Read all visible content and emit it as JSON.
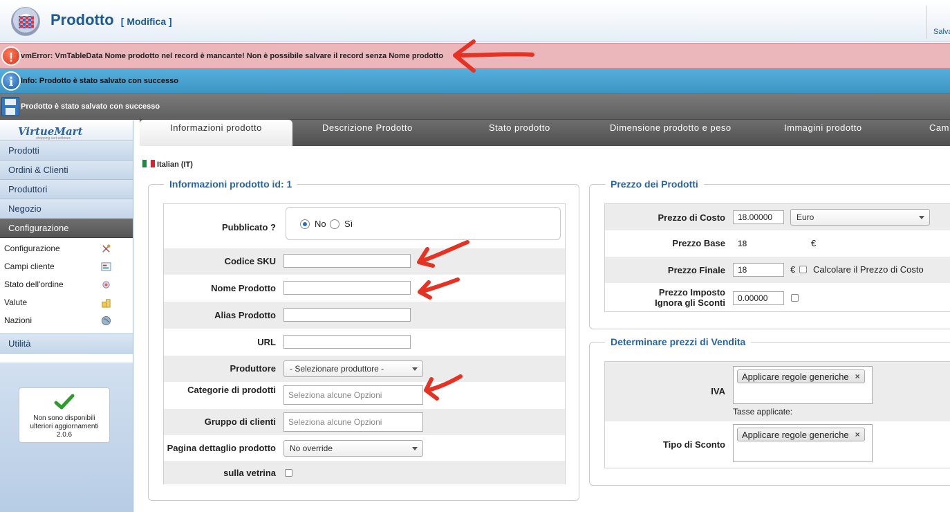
{
  "header": {
    "title": "Prodotto",
    "subtitle": "[ Modifica ]",
    "save_label": "Salva"
  },
  "messages": {
    "error": "vmError: VmTableData Nome prodotto nel record è mancante! Non è possibile salvare il record senza Nome prodotto",
    "info": "Info: Prodotto è stato salvato con successo",
    "saved": "Prodotto è stato salvato con successo",
    "error_icon": "!",
    "info_icon": "i"
  },
  "sidebar": {
    "logo": "VirtueMart",
    "logo_sub": "shopping cart software",
    "items": [
      "Prodotti",
      "Ordini & Clienti",
      "Produttori",
      "Negozio",
      "Configurazione"
    ],
    "active_item": "Configurazione",
    "submenu": [
      {
        "label": "Configurazione",
        "icon": "tools-icon"
      },
      {
        "label": "Campi cliente",
        "icon": "form-icon"
      },
      {
        "label": "Stato dell'ordine",
        "icon": "status-icon"
      },
      {
        "label": "Valute",
        "icon": "coins-icon"
      },
      {
        "label": "Nazioni",
        "icon": "globe-icon"
      }
    ],
    "utility": "Utilità",
    "update_line1": "Non sono disponibili",
    "update_line2": "ulteriori aggiornamenti",
    "update_version": "2.0.6"
  },
  "tabs": [
    {
      "label": "Informazioni prodotto",
      "active": true
    },
    {
      "label": "Descrizione Prodotto",
      "active": false
    },
    {
      "label": "Stato prodotto",
      "active": false
    },
    {
      "label": "Dimensione prodotto e peso",
      "active": false
    },
    {
      "label": "Immagini prodotto",
      "active": false
    },
    {
      "label": "Cam",
      "active": false
    }
  ],
  "language": "Italian (IT)",
  "product_info": {
    "legend": "Informazioni prodotto id: 1",
    "published_label": "Pubblicato ?",
    "published_no": "No",
    "published_yes": "Sì",
    "sku_label": "Codice SKU",
    "sku_value": "",
    "name_label": "Nome Prodotto",
    "name_value": "",
    "alias_label": "Alias Prodotto",
    "alias_value": "",
    "url_label": "URL",
    "url_value": "",
    "manufacturer_label": "Produttore",
    "manufacturer_value": "- Selezionare produttore -",
    "categories_label": "Categorie di prodotti",
    "categories_placeholder": "Seleziona alcune Opzioni",
    "group_label": "Gruppo di clienti",
    "group_placeholder": "Seleziona alcune Opzioni",
    "page_label": "Pagina dettaglio prodotto",
    "page_value": "No override",
    "showcase_label": "sulla vetrina"
  },
  "prices": {
    "legend": "Prezzo dei Prodotti",
    "cost_label": "Prezzo di Costo",
    "cost_value": "18.00000",
    "currency": "Euro",
    "base_label": "Prezzo Base",
    "base_value": "18",
    "euro": "€",
    "final_label": "Prezzo Finale",
    "final_value": "18",
    "calc_label": "Calcolare il Prezzo di Costo",
    "override_label1": "Prezzo Imposto",
    "override_label2": "Ignora gli Sconti",
    "override_value": "0.00000"
  },
  "sale": {
    "legend": "Determinare prezzi di Vendita",
    "vat_label": "IVA",
    "vat_tag": "Applicare regole generiche",
    "taxes_applied": "Tasse applicate:",
    "discount_label": "Tipo di Sconto",
    "discount_tag": "Applicare regole generiche"
  },
  "colors": {
    "accent": "#2a64a0",
    "error_bg": "#ecb7bb",
    "info_bg": "#4aa3d2",
    "arrow": "#e53222"
  }
}
